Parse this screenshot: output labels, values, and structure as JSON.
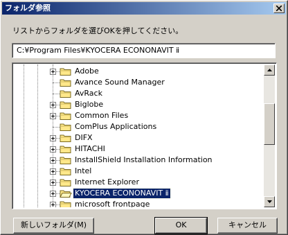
{
  "window": {
    "title": "フォルダ参照",
    "close_label": "close"
  },
  "instruction": "リストからフォルダを選びOKを押してください。",
  "path_value": "C:¥Program Files¥KYOCERA ECONONAVIT ⅱ",
  "tree": {
    "items": [
      {
        "label": "Adobe",
        "expandable": true,
        "selected": false
      },
      {
        "label": "Avance Sound Manager",
        "expandable": false,
        "selected": false
      },
      {
        "label": "AvRack",
        "expandable": false,
        "selected": false
      },
      {
        "label": "Biglobe",
        "expandable": true,
        "selected": false
      },
      {
        "label": "Common Files",
        "expandable": true,
        "selected": false
      },
      {
        "label": "ComPlus Applications",
        "expandable": false,
        "selected": false
      },
      {
        "label": "DIFX",
        "expandable": true,
        "selected": false
      },
      {
        "label": "HITACHI",
        "expandable": true,
        "selected": false
      },
      {
        "label": "InstallShield Installation Information",
        "expandable": true,
        "selected": false
      },
      {
        "label": "Intel",
        "expandable": true,
        "selected": false
      },
      {
        "label": "Internet Explorer",
        "expandable": true,
        "selected": false
      },
      {
        "label": "KYOCERA ECONONAVIT ⅱ",
        "expandable": true,
        "selected": true
      },
      {
        "label": "microsoft frontpage",
        "expandable": true,
        "selected": false
      }
    ]
  },
  "buttons": {
    "new_folder": "新しいフォルダ(M)",
    "ok": "OK",
    "cancel": "キャンセル"
  },
  "colors": {
    "titlebar": "#0a246a",
    "selection": "#0a246a",
    "folder": "#ffe88a"
  }
}
